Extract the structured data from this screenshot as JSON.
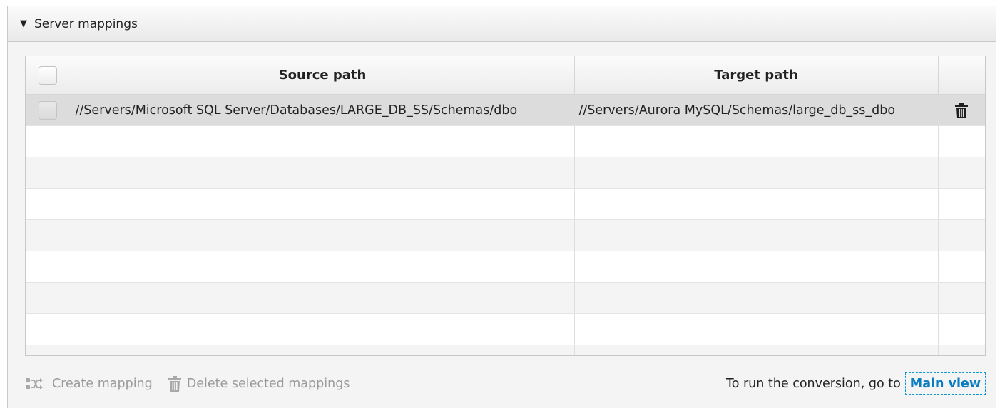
{
  "panel": {
    "title": "Server mappings",
    "collapse_icon": "triangle-down-icon"
  },
  "table": {
    "columns": {
      "source": "Source path",
      "target": "Target path"
    },
    "rows": [
      {
        "source": "//Servers/Microsoft SQL Server/Databases/LARGE_DB_SS/Schemas/dbo",
        "target": "//Servers/Aurora MySQL/Schemas/large_db_ss_dbo",
        "action_icon": "trash-icon"
      }
    ]
  },
  "footer": {
    "create_mapping": "Create mapping",
    "delete_selected": "Delete selected mappings",
    "hint": "To run the conversion, go to",
    "main_view_link": "Main view"
  },
  "colors": {
    "link": "#0a7dc2",
    "disabled_text": "#9a9a9a",
    "selected_row": "#dcdcdc"
  }
}
